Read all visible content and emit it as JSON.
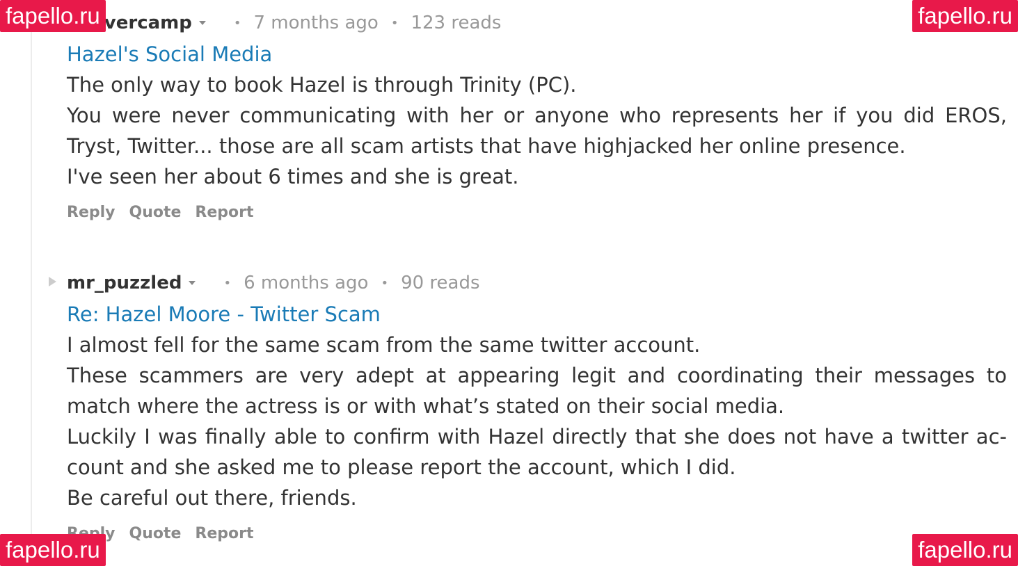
{
  "watermark": "fapello.ru",
  "posts": [
    {
      "author": "beavercamp",
      "time": "7 months ago",
      "reads": "123 reads",
      "title": "Hazel's Social Media",
      "paragraphs": [
        "The only way to book Hazel is through Trinity (PC).",
        "You were never communicating with her or anyone who represents her if you did EROS, Tryst, Twitter... those are all scam artists that have highjacked her online presence.",
        "I've seen her about 6 times and she is great."
      ],
      "actions": {
        "reply": "Reply",
        "quote": "Quote",
        "report": "Report"
      }
    },
    {
      "author": "mr_puzzled",
      "time": "6 months ago",
      "reads": "90 reads",
      "title": "Re: Hazel Moore - Twitter Scam",
      "paragraphs": [
        "I almost fell for the same scam from the same twitter account.",
        "These scammers are very adept at appearing legit and coordinating their messages to match where the actress is or with what’s stated on their social media.",
        "Luckily I was finally able to confirm with Hazel directly that she does not have a twitter ac-count and she asked me to please report the account, which I did.",
        "Be careful out there, friends."
      ],
      "actions": {
        "reply": "Reply",
        "quote": "Quote",
        "report": "Report"
      }
    }
  ],
  "separator": "•",
  "colors": {
    "title_link": "#1a7bb6",
    "body_text": "#333333",
    "muted": "#999999",
    "watermark_bg": "#e8194a"
  },
  "icons": {
    "author_menu": "chevron-down-icon",
    "collapse": "triangle-right-icon"
  }
}
